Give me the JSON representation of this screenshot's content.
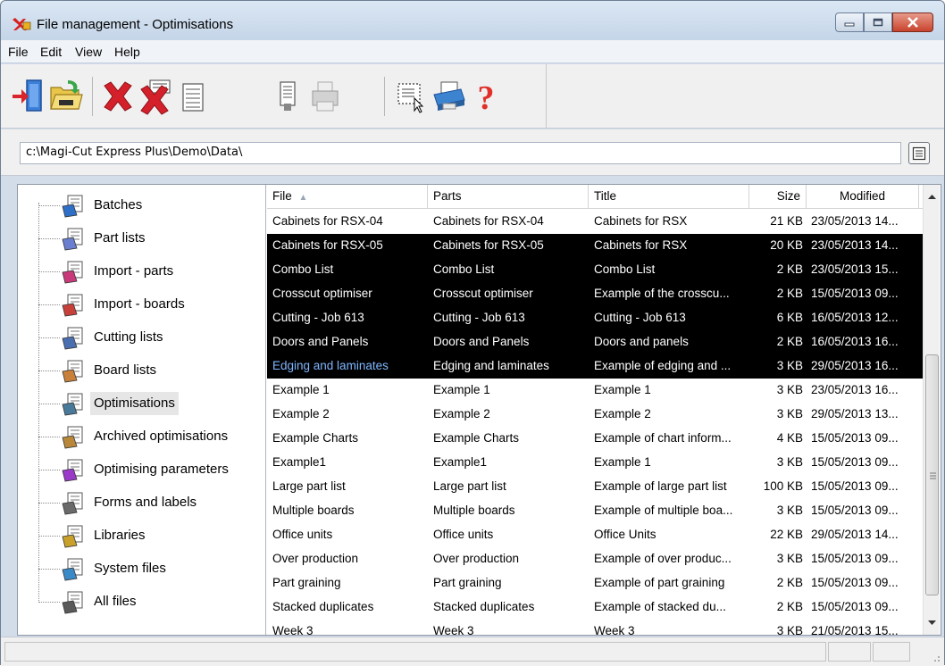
{
  "window": {
    "title": "File management - Optimisations"
  },
  "menu": [
    "File",
    "Edit",
    "View",
    "Help"
  ],
  "toolbar": {
    "buttons": [
      "exit-icon",
      "open-folder-icon",
      "delete-icon",
      "delete-all-icon",
      "properties-icon",
      "print-preview-icon",
      "printer-disabled-icon",
      "select-icon",
      "print-icon",
      "help-icon"
    ]
  },
  "path": {
    "value": "c:\\Magi-Cut Express Plus\\Demo\\Data\\"
  },
  "tree": {
    "items": [
      {
        "label": "Batches",
        "icon": "batches-icon"
      },
      {
        "label": "Part lists",
        "icon": "part-lists-icon"
      },
      {
        "label": "Import - parts",
        "icon": "import-parts-icon"
      },
      {
        "label": "Import - boards",
        "icon": "import-boards-icon"
      },
      {
        "label": "Cutting lists",
        "icon": "cutting-lists-icon"
      },
      {
        "label": "Board lists",
        "icon": "board-lists-icon"
      },
      {
        "label": "Optimisations",
        "icon": "optimisations-icon"
      },
      {
        "label": "Archived optimisations",
        "icon": "archived-optimisations-icon"
      },
      {
        "label": "Optimising parameters",
        "icon": "optimising-parameters-icon"
      },
      {
        "label": "Forms and labels",
        "icon": "forms-labels-icon"
      },
      {
        "label": "Libraries",
        "icon": "libraries-icon"
      },
      {
        "label": "System files",
        "icon": "system-files-icon"
      },
      {
        "label": "All files",
        "icon": "all-files-icon"
      }
    ],
    "selected": "Optimisations"
  },
  "list": {
    "columns": [
      "File",
      "Parts",
      "Title",
      "Size",
      "Modified"
    ],
    "sort_indicator": "▲",
    "rows": [
      {
        "file": "Cabinets for RSX-04",
        "parts": "Cabinets for RSX-04",
        "title": "Cabinets for RSX",
        "size": "21 KB",
        "modified": "23/05/2013 14...",
        "selected": false
      },
      {
        "file": "Cabinets for RSX-05",
        "parts": "Cabinets for RSX-05",
        "title": "Cabinets for RSX",
        "size": "20 KB",
        "modified": "23/05/2013 14...",
        "selected": true
      },
      {
        "file": "Combo List",
        "parts": "Combo List",
        "title": "Combo List",
        "size": "2 KB",
        "modified": "23/05/2013 15...",
        "selected": true
      },
      {
        "file": "Crosscut optimiser",
        "parts": "Crosscut optimiser",
        "title": "Example of the crosscu...",
        "size": "2 KB",
        "modified": "15/05/2013 09...",
        "selected": true
      },
      {
        "file": "Cutting - Job 613",
        "parts": "Cutting - Job 613",
        "title": "Cutting - Job 613",
        "size": "6 KB",
        "modified": "16/05/2013 12...",
        "selected": true
      },
      {
        "file": "Doors and Panels",
        "parts": "Doors and Panels",
        "title": "Doors and panels",
        "size": "2 KB",
        "modified": "16/05/2013 16...",
        "selected": true
      },
      {
        "file": "Edging and laminates",
        "parts": "Edging and laminates",
        "title": "Example of edging and ...",
        "size": "3 KB",
        "modified": "29/05/2013 16...",
        "selected": true,
        "focused": true
      },
      {
        "file": "Example 1",
        "parts": "Example 1",
        "title": "Example 1",
        "size": "3 KB",
        "modified": "23/05/2013 16...",
        "selected": false
      },
      {
        "file": "Example 2",
        "parts": "Example 2",
        "title": "Example 2",
        "size": "3 KB",
        "modified": "29/05/2013 13...",
        "selected": false
      },
      {
        "file": "Example Charts",
        "parts": "Example Charts",
        "title": "Example of chart inform...",
        "size": "4 KB",
        "modified": "15/05/2013 09...",
        "selected": false
      },
      {
        "file": "Example1",
        "parts": "Example1",
        "title": "Example 1",
        "size": "3 KB",
        "modified": "15/05/2013 09...",
        "selected": false
      },
      {
        "file": "Large part list",
        "parts": "Large part list",
        "title": "Example of large part list",
        "size": "100 KB",
        "modified": "15/05/2013 09...",
        "selected": false
      },
      {
        "file": "Multiple boards",
        "parts": "Multiple boards",
        "title": "Example of multiple boa...",
        "size": "3 KB",
        "modified": "15/05/2013 09...",
        "selected": false
      },
      {
        "file": "Office units",
        "parts": "Office units",
        "title": "Office Units",
        "size": "22 KB",
        "modified": "29/05/2013 14...",
        "selected": false
      },
      {
        "file": "Over production",
        "parts": "Over production",
        "title": "Example of over produc...",
        "size": "3 KB",
        "modified": "15/05/2013 09...",
        "selected": false
      },
      {
        "file": "Part graining",
        "parts": "Part graining",
        "title": "Example of part graining",
        "size": "2 KB",
        "modified": "15/05/2013 09...",
        "selected": false
      },
      {
        "file": "Stacked duplicates",
        "parts": "Stacked duplicates",
        "title": "Example of stacked du...",
        "size": "2 KB",
        "modified": "15/05/2013 09...",
        "selected": false
      },
      {
        "file": "Week 3",
        "parts": "Week 3",
        "title": "Week 3",
        "size": "3 KB",
        "modified": "21/05/2013 15...",
        "selected": false
      }
    ]
  },
  "colors": {
    "selection": "#000000",
    "focused_text": "#7fb6ff",
    "delete_red": "#d4202a",
    "help_red": "#e0302a"
  }
}
